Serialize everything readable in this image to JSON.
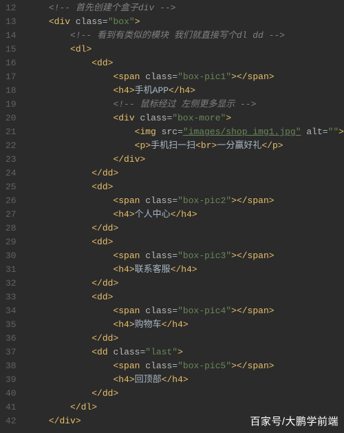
{
  "lines": [
    {
      "n": 12,
      "indent": 1,
      "kind": "comment",
      "text": "首先创建个盒子div"
    },
    {
      "n": 13,
      "indent": 1,
      "kind": "open",
      "tag": "div",
      "attrs": [
        {
          "k": "class",
          "v": "box"
        }
      ]
    },
    {
      "n": 14,
      "indent": 2,
      "kind": "comment",
      "text": "看到有类似的模块 我们就直接写个dl dd"
    },
    {
      "n": 15,
      "indent": 2,
      "kind": "open",
      "tag": "dl"
    },
    {
      "n": 16,
      "indent": 3,
      "kind": "open",
      "tag": "dd"
    },
    {
      "n": 17,
      "indent": 4,
      "kind": "span-empty",
      "cls": "box-pic1"
    },
    {
      "n": 18,
      "indent": 4,
      "kind": "h4",
      "text": "手机APP"
    },
    {
      "n": 19,
      "indent": 4,
      "kind": "comment",
      "text": "鼠标经过 左侧更多显示"
    },
    {
      "n": 20,
      "indent": 4,
      "kind": "open",
      "tag": "div",
      "attrs": [
        {
          "k": "class",
          "v": "box-more"
        }
      ]
    },
    {
      "n": 21,
      "indent": 5,
      "kind": "img",
      "src": "images/shop_img1.jpg",
      "alt": ""
    },
    {
      "n": 22,
      "indent": 5,
      "kind": "p-br",
      "before": "手机扫一扫",
      "after": "一分赢好礼"
    },
    {
      "n": 23,
      "indent": 4,
      "kind": "close",
      "tag": "div"
    },
    {
      "n": 24,
      "indent": 3,
      "kind": "close",
      "tag": "dd"
    },
    {
      "n": 25,
      "indent": 3,
      "kind": "open",
      "tag": "dd"
    },
    {
      "n": 26,
      "indent": 4,
      "kind": "span-empty",
      "cls": "box-pic2"
    },
    {
      "n": 27,
      "indent": 4,
      "kind": "h4",
      "text": "个人中心"
    },
    {
      "n": 28,
      "indent": 3,
      "kind": "close",
      "tag": "dd"
    },
    {
      "n": 29,
      "indent": 3,
      "kind": "open",
      "tag": "dd"
    },
    {
      "n": 30,
      "indent": 4,
      "kind": "span-empty",
      "cls": "box-pic3"
    },
    {
      "n": 31,
      "indent": 4,
      "kind": "h4",
      "text": "联系客服"
    },
    {
      "n": 32,
      "indent": 3,
      "kind": "close",
      "tag": "dd"
    },
    {
      "n": 33,
      "indent": 3,
      "kind": "open",
      "tag": "dd"
    },
    {
      "n": 34,
      "indent": 4,
      "kind": "span-empty",
      "cls": "box-pic4"
    },
    {
      "n": 35,
      "indent": 4,
      "kind": "h4",
      "text": "购物车"
    },
    {
      "n": 36,
      "indent": 3,
      "kind": "close",
      "tag": "dd"
    },
    {
      "n": 37,
      "indent": 3,
      "kind": "open",
      "tag": "dd",
      "attrs": [
        {
          "k": "class",
          "v": "last"
        }
      ]
    },
    {
      "n": 38,
      "indent": 4,
      "kind": "span-empty",
      "cls": "box-pic5"
    },
    {
      "n": 39,
      "indent": 4,
      "kind": "h4",
      "text": "回顶部"
    },
    {
      "n": 40,
      "indent": 3,
      "kind": "close",
      "tag": "dd"
    },
    {
      "n": 41,
      "indent": 2,
      "kind": "close",
      "tag": "dl"
    },
    {
      "n": 42,
      "indent": 1,
      "kind": "close",
      "tag": "div"
    }
  ],
  "footer": "百家号/大鹏学前端"
}
